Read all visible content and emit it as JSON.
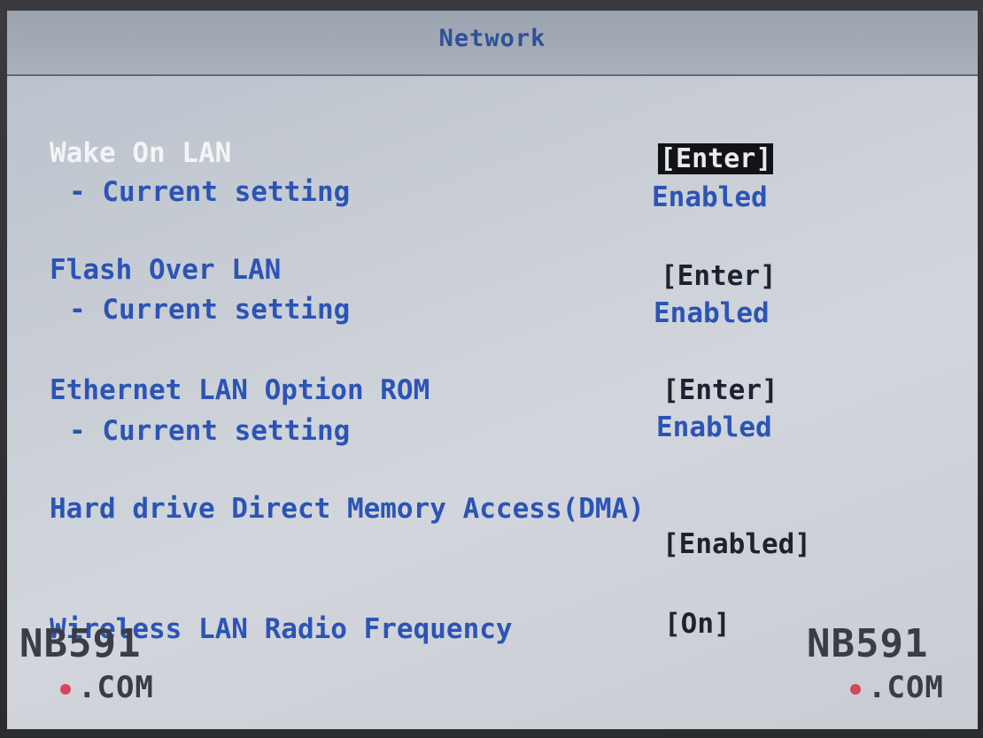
{
  "header": {
    "title": "Network"
  },
  "items": [
    {
      "label": "Wake On LAN",
      "action": "[Enter]",
      "sub_label": "- Current setting",
      "sub_value": "Enabled"
    },
    {
      "label": "Flash Over LAN",
      "action": "[Enter]",
      "sub_label": "- Current setting",
      "sub_value": "Enabled"
    },
    {
      "label": "Ethernet LAN Option ROM",
      "action": "[Enter]",
      "sub_label": "- Current setting",
      "sub_value": "Enabled"
    },
    {
      "label": "Hard drive Direct Memory Access(DMA)",
      "value": "[Enabled]"
    },
    {
      "label": "Wireless LAN Radio Frequency",
      "value": "[On]"
    }
  ],
  "watermark": {
    "left_top": "NB591",
    "left_bottom": ".COM",
    "right_top": "NB591",
    "right_bottom": ".COM",
    "dot_color": "#d3475a"
  },
  "colors": {
    "selected_label": "#f4f4f6",
    "label_blue": "#2b54b5",
    "value_dark": "#1d2230",
    "title_blue": "#2f4f9a"
  }
}
